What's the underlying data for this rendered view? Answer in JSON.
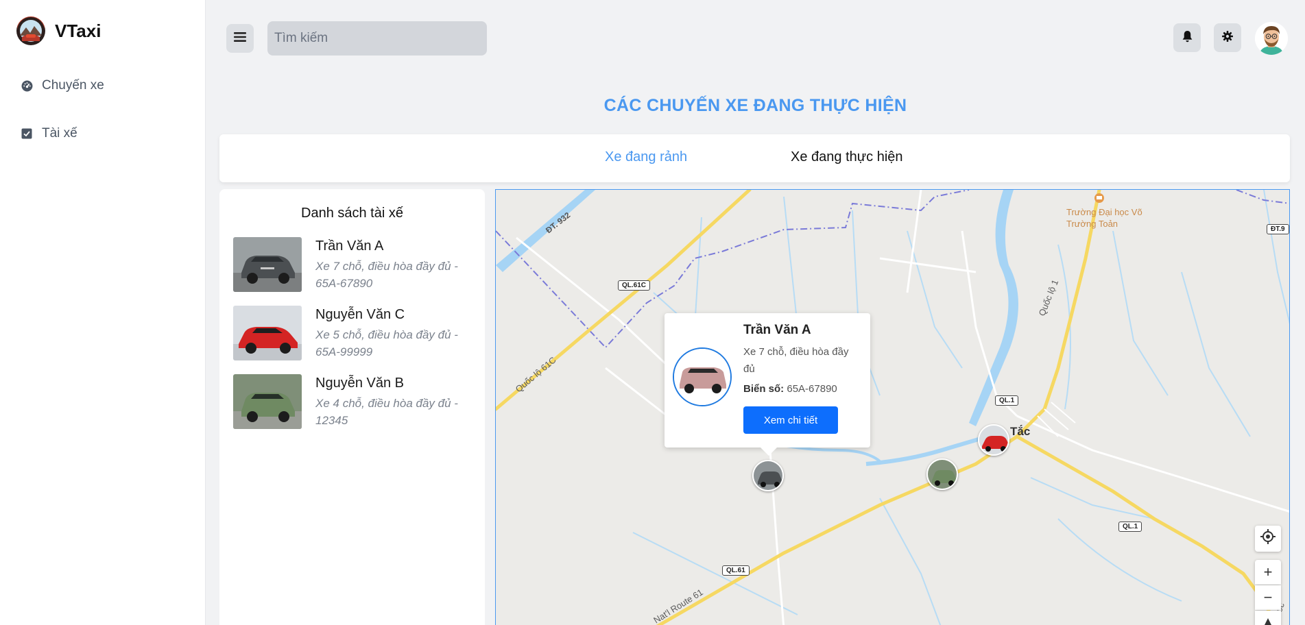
{
  "app": {
    "name": "VTaxi"
  },
  "sidebar": {
    "items": [
      {
        "label": "Chuyến xe",
        "icon": "gauge-icon"
      },
      {
        "label": "Tài xế",
        "icon": "checkbox-icon"
      }
    ]
  },
  "header": {
    "search_placeholder": "Tìm kiếm"
  },
  "page": {
    "title": "CÁC CHUYẾN XE ĐANG THỰC HIỆN",
    "tabs": [
      {
        "label": "Xe đang rảnh",
        "active": false
      },
      {
        "label": "Xe đang thực hiện",
        "active": true
      }
    ]
  },
  "driver_list": {
    "title": "Danh sách tài xế",
    "drivers": [
      {
        "name": "Trần Văn A",
        "desc": "Xe 7 chỗ, điều hòa đầy đủ - 65A-67890"
      },
      {
        "name": "Nguyễn Văn C",
        "desc": "Xe 5 chỗ, điều hòa đầy đủ - 65A-99999"
      },
      {
        "name": "Nguyễn Văn B",
        "desc": "Xe 4 chỗ, điều hòa đầy đủ - 12345"
      }
    ]
  },
  "map": {
    "labels": {
      "dt932": "ĐT. 932",
      "ql61c": "QL.61C",
      "quoc_lo_61c": "Quốc lộ 61C",
      "ql1_a": "QL.1",
      "ql1_b": "QL.1",
      "ql61": "QL.61",
      "quoc_lo_1": "Quốc lộ 1",
      "nat_route_61": "Nat'l Route 61",
      "tac": "Tắc",
      "university": "Trường Đại học Võ Trường Toản",
      "dt9": "ĐT.9",
      "quoc_right": "Quốc"
    },
    "popup": {
      "name": "Trần Văn A",
      "desc": "Xe 7 chỗ, điều hòa đầy đủ",
      "plate_label": "Biển số:",
      "plate_value": "65A-67890",
      "button": "Xem chi tiết"
    },
    "controls": {
      "zoom_in": "+",
      "zoom_out": "−"
    }
  },
  "colors": {
    "accent": "#4a98f0",
    "button": "#0d6efd",
    "road_major": "#f6d862",
    "water": "#a6d4f5",
    "boundary": "#7a7ad8"
  }
}
